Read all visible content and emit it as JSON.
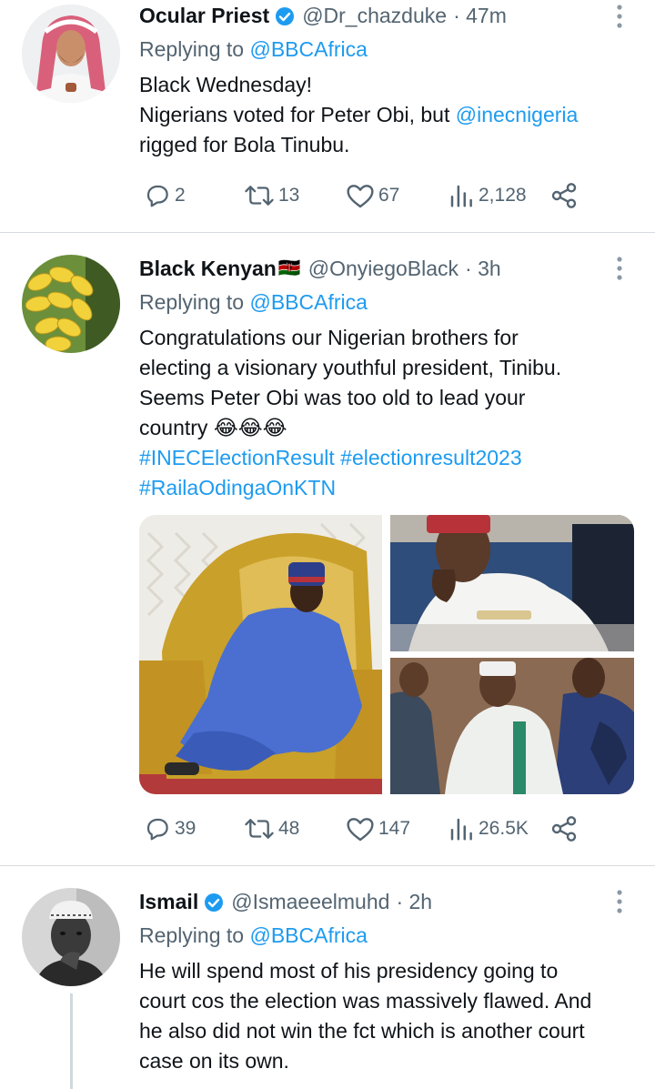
{
  "tweets": [
    {
      "name": "Ocular Priest",
      "verified": true,
      "handle": "@Dr_chazduke",
      "time": "· 47m",
      "replying_prefix": "Replying to ",
      "replying_to": "@BBCAfrica",
      "lines": [
        "Black Wednesday!",
        "Nigerians voted for Peter Obi, but ",
        "@inecnigeria",
        "rigged for Bola Tinubu."
      ],
      "replies": "2",
      "retweets": "13",
      "likes": "67",
      "views": "2,128"
    },
    {
      "name": "Black Kenyan",
      "flag": "🇰🇪",
      "handle": "@OnyiegoBlack",
      "time": "· 3h",
      "replying_prefix": "Replying to ",
      "replying_to": "@BBCAfrica",
      "lines": [
        "Congratulations our Nigerian brothers for",
        "electing a visionary youthful president, Tinibu.",
        "Seems Peter Obi was too old to lead your",
        "country 😂😂😂"
      ],
      "hashtags": [
        "#INECElectionResult",
        "#electionresult2023",
        "#RailaOdingaOnKTN"
      ],
      "replies": "39",
      "retweets": "48",
      "likes": "147",
      "views": "26.5K"
    },
    {
      "name": "Ismail",
      "verified": true,
      "handle": "@Ismaeeelmuhd",
      "time": "· 2h",
      "replying_prefix": "Replying to ",
      "replying_to": "@BBCAfrica",
      "lines": [
        "He will spend most of his presidency going to",
        "court cos the election was massively flawed. And",
        "he also did not win the fct which is another court",
        "case on its own."
      ]
    }
  ],
  "colors": {
    "accent": "#1d9bf0",
    "secondary_text": "#536471",
    "divider": "#d6dbdf"
  },
  "icons": [
    "reply-icon",
    "retweet-icon",
    "like-icon",
    "views-icon",
    "share-icon",
    "verified-icon",
    "more-icon"
  ]
}
